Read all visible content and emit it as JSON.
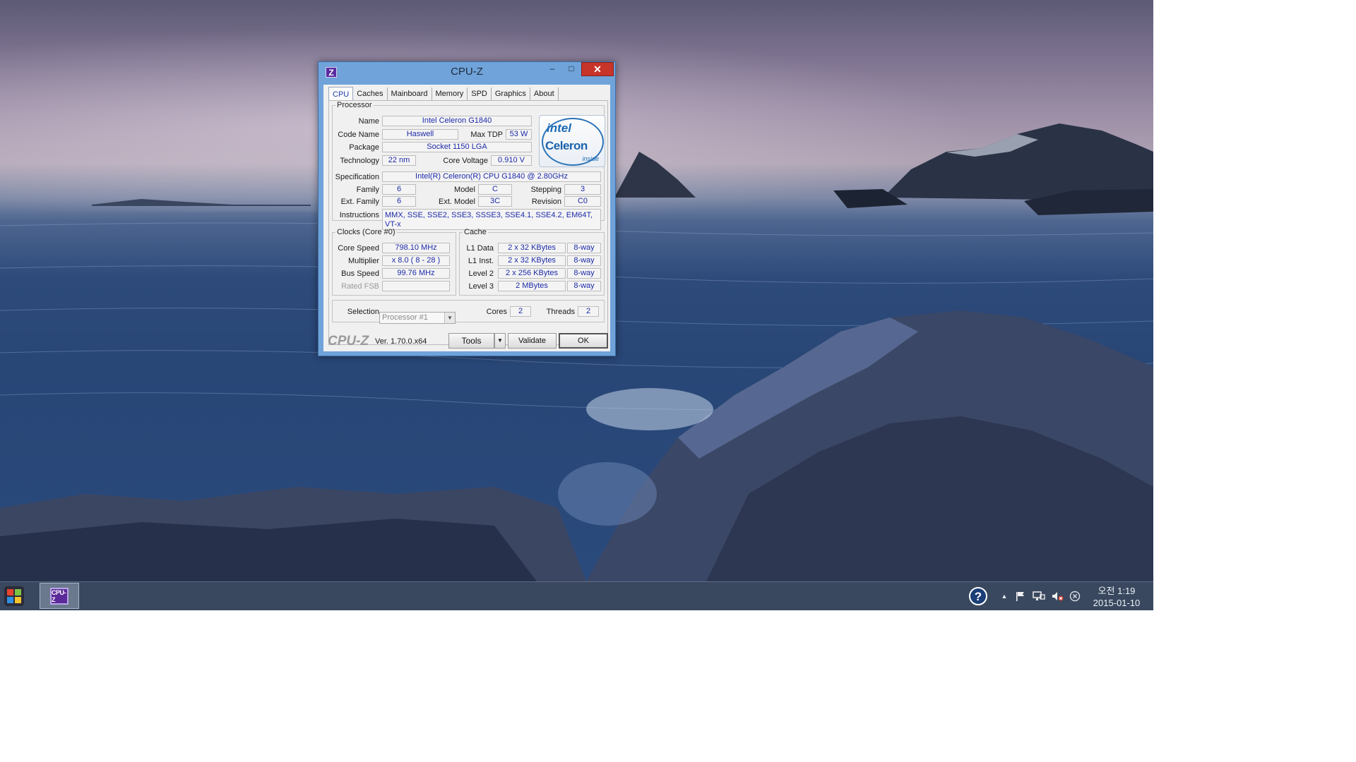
{
  "window": {
    "title": "CPU-Z",
    "icon_letter": "Z",
    "minimize": "–",
    "maximize": "□",
    "close": "✕"
  },
  "tabs": [
    "CPU",
    "Caches",
    "Mainboard",
    "Memory",
    "SPD",
    "Graphics",
    "About"
  ],
  "active_tab": "CPU",
  "processor": {
    "legend": "Processor",
    "name_label": "Name",
    "name": "Intel Celeron G1840",
    "codename_label": "Code Name",
    "codename": "Haswell",
    "maxtdp_label": "Max TDP",
    "maxtdp": "53 W",
    "package_label": "Package",
    "package": "Socket 1150 LGA",
    "technology_label": "Technology",
    "technology": "22 nm",
    "corevoltage_label": "Core Voltage",
    "corevoltage": "0.910 V",
    "specification_label": "Specification",
    "specification": "Intel(R) Celeron(R) CPU G1840 @ 2.80GHz",
    "family_label": "Family",
    "family": "6",
    "model_label": "Model",
    "model": "C",
    "stepping_label": "Stepping",
    "stepping": "3",
    "extfamily_label": "Ext. Family",
    "extfamily": "6",
    "extmodel_label": "Ext. Model",
    "extmodel": "3C",
    "revision_label": "Revision",
    "revision": "C0",
    "instructions_label": "Instructions",
    "instructions": "MMX, SSE, SSE2, SSE3, SSSE3, SSE4.1, SSE4.2, EM64T, VT-x",
    "logo_top": "intel",
    "logo_brand": "Celeron",
    "logo_inside": "inside"
  },
  "clocks": {
    "legend": "Clocks (Core #0)",
    "corespeed_label": "Core Speed",
    "corespeed": "798.10 MHz",
    "multiplier_label": "Multiplier",
    "multiplier": "x 8.0 ( 8 - 28 )",
    "busspeed_label": "Bus Speed",
    "busspeed": "99.76 MHz",
    "ratedfsb_label": "Rated FSB",
    "ratedfsb": ""
  },
  "cache": {
    "legend": "Cache",
    "rows": [
      {
        "label": "L1 Data",
        "size": "2 x 32 KBytes",
        "way": "8-way"
      },
      {
        "label": "L1 Inst.",
        "size": "2 x 32 KBytes",
        "way": "8-way"
      },
      {
        "label": "Level 2",
        "size": "2 x 256 KBytes",
        "way": "8-way"
      },
      {
        "label": "Level 3",
        "size": "2 MBytes",
        "way": "8-way"
      }
    ]
  },
  "selection": {
    "label": "Selection",
    "value": "Processor #1",
    "cores_label": "Cores",
    "cores": "2",
    "threads_label": "Threads",
    "threads": "2"
  },
  "footer": {
    "brand": "CPU-Z",
    "version": "Ver. 1.70.0.x64",
    "tools": "Tools",
    "validate": "Validate",
    "ok": "OK"
  },
  "taskbar": {
    "app_label": "CPU-Z",
    "clock_time": "오전 1:19",
    "clock_date": "2015-01-10",
    "tray_icons": [
      "help-icon",
      "show-hidden-icons-chevron",
      "action-center-flag-icon",
      "network-icon",
      "volume-muted-icon",
      "close-circle-icon"
    ]
  },
  "colors": {
    "title_bar": "#6fa3d9",
    "close_button": "#c7342a",
    "value_text": "#1d2aa8",
    "intel_blue": "#1b6ab5",
    "cpuz_purple": "#5a2ca0"
  }
}
